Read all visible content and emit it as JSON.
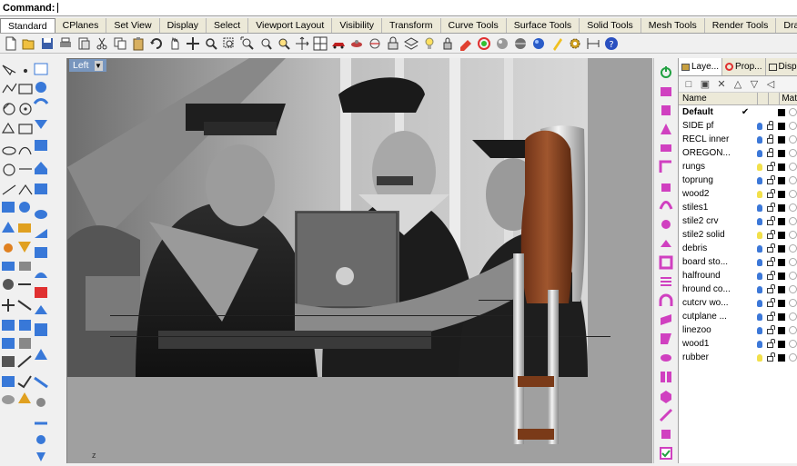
{
  "command": {
    "label": "Command:"
  },
  "tabs": [
    "Standard",
    "CPlanes",
    "Set View",
    "Display",
    "Select",
    "Viewport Layout",
    "Visibility",
    "Transform",
    "Curve Tools",
    "Surface Tools",
    "Solid Tools",
    "Mesh Tools",
    "Render Tools",
    "Draft"
  ],
  "viewport": {
    "title": "Left",
    "axis_label": "z"
  },
  "panel": {
    "tabs": [
      "Laye...",
      "Prop...",
      "Disp"
    ],
    "columns": {
      "name": "Name",
      "material": "Mat"
    },
    "layers": [
      {
        "name": "Default",
        "current": true,
        "bold": true,
        "bulb": "",
        "lock": "",
        "color": "#000000"
      },
      {
        "name": "SIDE pf",
        "current": false,
        "bulb": "#3c78d8",
        "lock": "closed",
        "color": "#000000"
      },
      {
        "name": "RECL inner",
        "current": false,
        "bulb": "#3c78d8",
        "lock": "closed",
        "color": "#000000"
      },
      {
        "name": "OREGON...",
        "current": false,
        "bulb": "#3c78d8",
        "lock": "closed",
        "color": "#000000"
      },
      {
        "name": "rungs",
        "current": false,
        "bulb": "#f2e04a",
        "lock": "open",
        "color": "#000000"
      },
      {
        "name": "toprung",
        "current": false,
        "bulb": "#3c78d8",
        "lock": "open",
        "color": "#000000"
      },
      {
        "name": "wood2",
        "current": false,
        "bulb": "#f2e04a",
        "lock": "open",
        "color": "#000000"
      },
      {
        "name": "stiles1",
        "current": false,
        "bulb": "#3c78d8",
        "lock": "open",
        "color": "#000000"
      },
      {
        "name": "stile2 crv",
        "current": false,
        "bulb": "#3c78d8",
        "lock": "open",
        "color": "#000000"
      },
      {
        "name": "stile2 solid",
        "current": false,
        "bulb": "#f2e04a",
        "lock": "open",
        "color": "#000000"
      },
      {
        "name": "debris",
        "current": false,
        "bulb": "#3c78d8",
        "lock": "open",
        "color": "#000000"
      },
      {
        "name": "board sto...",
        "current": false,
        "bulb": "#3c78d8",
        "lock": "open",
        "color": "#000000"
      },
      {
        "name": "halfround",
        "current": false,
        "bulb": "#3c78d8",
        "lock": "open",
        "color": "#000000"
      },
      {
        "name": "hround co...",
        "current": false,
        "bulb": "#3c78d8",
        "lock": "open",
        "color": "#000000"
      },
      {
        "name": "cutcrv wo...",
        "current": false,
        "bulb": "#3c78d8",
        "lock": "open",
        "color": "#000000"
      },
      {
        "name": "cutplane ...",
        "current": false,
        "bulb": "#3c78d8",
        "lock": "open",
        "color": "#000000"
      },
      {
        "name": "linezoo",
        "current": false,
        "bulb": "#3c78d8",
        "lock": "open",
        "color": "#000000"
      },
      {
        "name": "wood1",
        "current": false,
        "bulb": "#3c78d8",
        "lock": "open",
        "color": "#000000"
      },
      {
        "name": "rubber",
        "current": false,
        "bulb": "#f2e04a",
        "lock": "open",
        "color": "#000000"
      }
    ]
  },
  "colors": {
    "viewport_bg": "#a0a0a0",
    "title_bar": "#7896be",
    "wood": "#8b4a2b"
  }
}
